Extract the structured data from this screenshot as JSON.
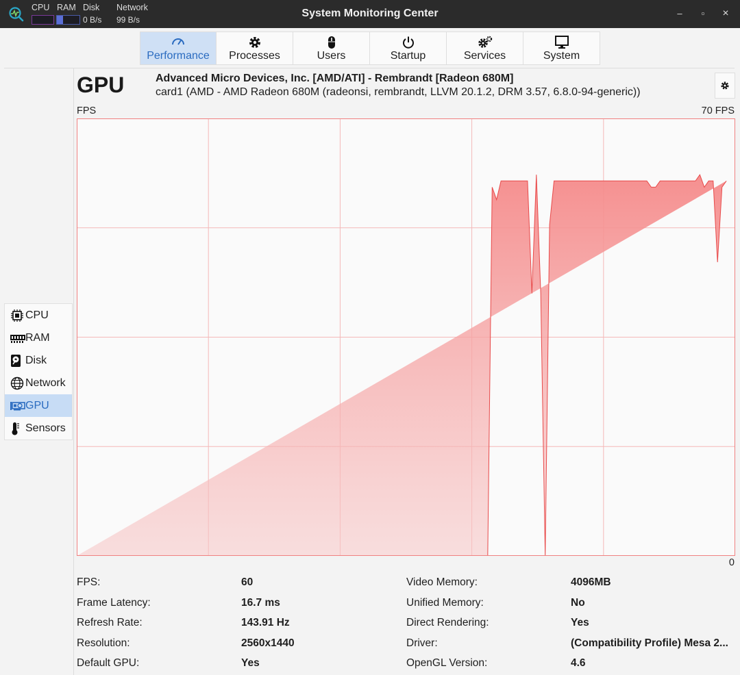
{
  "titlebar": {
    "title": "System Monitoring Center",
    "cpu_label": "CPU",
    "ram_label": "RAM",
    "disk_label": "Disk",
    "network_label": "Network",
    "disk_value": "0 B/s",
    "network_value": "99 B/s",
    "ram_fill_fraction": 0.28,
    "cpu_fill_fraction": 0.0,
    "minimize": "–",
    "maximize": "▫",
    "close": "×"
  },
  "tabs": [
    {
      "label": "Performance",
      "icon": "gauge-icon",
      "active": true
    },
    {
      "label": "Processes",
      "icon": "gear-icon",
      "active": false
    },
    {
      "label": "Users",
      "icon": "mouse-icon",
      "active": false
    },
    {
      "label": "Startup",
      "icon": "power-icon",
      "active": false
    },
    {
      "label": "Services",
      "icon": "gears-icon",
      "active": false
    },
    {
      "label": "System",
      "icon": "monitor-icon",
      "active": false
    }
  ],
  "sidebar": {
    "items": [
      {
        "label": "CPU",
        "icon": "cpu-chip-icon",
        "active": false
      },
      {
        "label": "RAM",
        "icon": "ram-module-icon",
        "active": false
      },
      {
        "label": "Disk",
        "icon": "hard-disk-icon",
        "active": false
      },
      {
        "label": "Network",
        "icon": "globe-icon",
        "active": false
      },
      {
        "label": "GPU",
        "icon": "graphics-card-icon",
        "active": true
      },
      {
        "label": "Sensors",
        "icon": "thermometer-icon",
        "active": false
      }
    ]
  },
  "header": {
    "title": "GPU",
    "device_name": "Advanced Micro Devices, Inc. [AMD/ATI] - Rembrandt [Radeon 680M]",
    "device_details": "card1 (AMD - AMD Radeon 680M (radeonsi, rembrandt, LLVM 20.1.2, DRM 3.57, 6.8.0-94-generic))"
  },
  "chart_data": {
    "type": "area",
    "ylabel": "FPS",
    "ymax_label": "70 FPS",
    "ymin_label": "0",
    "ylim": [
      0,
      70
    ],
    "grid": true,
    "color": "#f08080",
    "x": [
      0,
      1,
      2,
      3,
      4,
      5,
      6,
      7,
      8,
      9,
      10,
      11,
      12,
      13,
      14,
      15,
      16,
      17,
      18,
      19,
      20,
      21,
      22,
      23,
      24,
      25,
      26,
      27,
      28,
      29,
      30,
      31,
      32,
      33,
      34,
      35,
      36,
      37,
      38,
      39,
      40,
      41,
      42,
      43,
      44,
      45,
      46,
      47,
      48,
      49,
      50,
      51,
      52,
      53,
      54,
      55,
      56,
      57,
      58,
      59,
      60,
      61,
      62,
      63,
      64,
      65,
      66,
      67,
      68,
      69,
      70,
      71,
      72,
      73,
      74,
      75,
      76,
      77,
      78,
      79,
      80,
      81,
      82,
      83,
      84,
      85,
      86,
      87,
      88,
      89,
      90,
      91,
      92,
      93,
      94,
      95,
      96,
      97,
      98,
      99,
      100,
      101,
      102,
      103,
      104,
      105,
      106,
      107,
      108,
      109,
      110,
      111,
      112,
      113,
      114,
      115,
      116,
      117,
      118,
      119,
      120,
      121,
      122,
      123,
      124,
      125,
      126,
      127,
      128,
      129,
      130,
      131,
      132,
      133,
      134,
      135,
      136,
      137,
      138,
      139,
      140,
      141,
      142,
      143,
      144,
      145,
      146,
      147,
      148,
      149
    ],
    "values": [
      0,
      0,
      0,
      0,
      0,
      0,
      0,
      0,
      0,
      0,
      0,
      0,
      0,
      0,
      0,
      0,
      0,
      0,
      0,
      0,
      0,
      0,
      0,
      0,
      0,
      0,
      0,
      0,
      0,
      0,
      0,
      0,
      0,
      0,
      0,
      0,
      0,
      0,
      0,
      0,
      0,
      0,
      0,
      0,
      0,
      0,
      0,
      0,
      0,
      0,
      0,
      0,
      0,
      0,
      0,
      0,
      0,
      0,
      0,
      0,
      0,
      0,
      0,
      0,
      0,
      0,
      0,
      0,
      0,
      0,
      0,
      0,
      0,
      0,
      0,
      0,
      0,
      0,
      0,
      0,
      0,
      0,
      0,
      0,
      0,
      0,
      0,
      0,
      0,
      0,
      0,
      0,
      0,
      0,
      59,
      57,
      60,
      60,
      60,
      60,
      60,
      60,
      60,
      42,
      61,
      42,
      0,
      53,
      60,
      60,
      60,
      60,
      60,
      60,
      60,
      60,
      60,
      60,
      60,
      60,
      60,
      60,
      60,
      60,
      60,
      60,
      60,
      60,
      60,
      60,
      59,
      59,
      60,
      60,
      60,
      60,
      60,
      60,
      60,
      60,
      60,
      61,
      59,
      60,
      60,
      47,
      59,
      60
    ],
    "x_range": [
      0,
      149
    ]
  },
  "info": {
    "left": [
      {
        "key": "FPS:",
        "value": "60"
      },
      {
        "key": "Frame Latency:",
        "value": "16.7 ms"
      },
      {
        "key": "Refresh Rate:",
        "value": "143.91 Hz"
      },
      {
        "key": "Resolution:",
        "value": "2560x1440"
      },
      {
        "key": "Default GPU:",
        "value": "Yes"
      }
    ],
    "right": [
      {
        "key": "Video Memory:",
        "value": "4096MB"
      },
      {
        "key": "Unified Memory:",
        "value": "No"
      },
      {
        "key": "Direct Rendering:",
        "value": "Yes"
      },
      {
        "key": "Driver:",
        "value": "(Compatibility Profile) Mesa 2..."
      },
      {
        "key": "OpenGL Version:",
        "value": "4.6"
      }
    ]
  }
}
